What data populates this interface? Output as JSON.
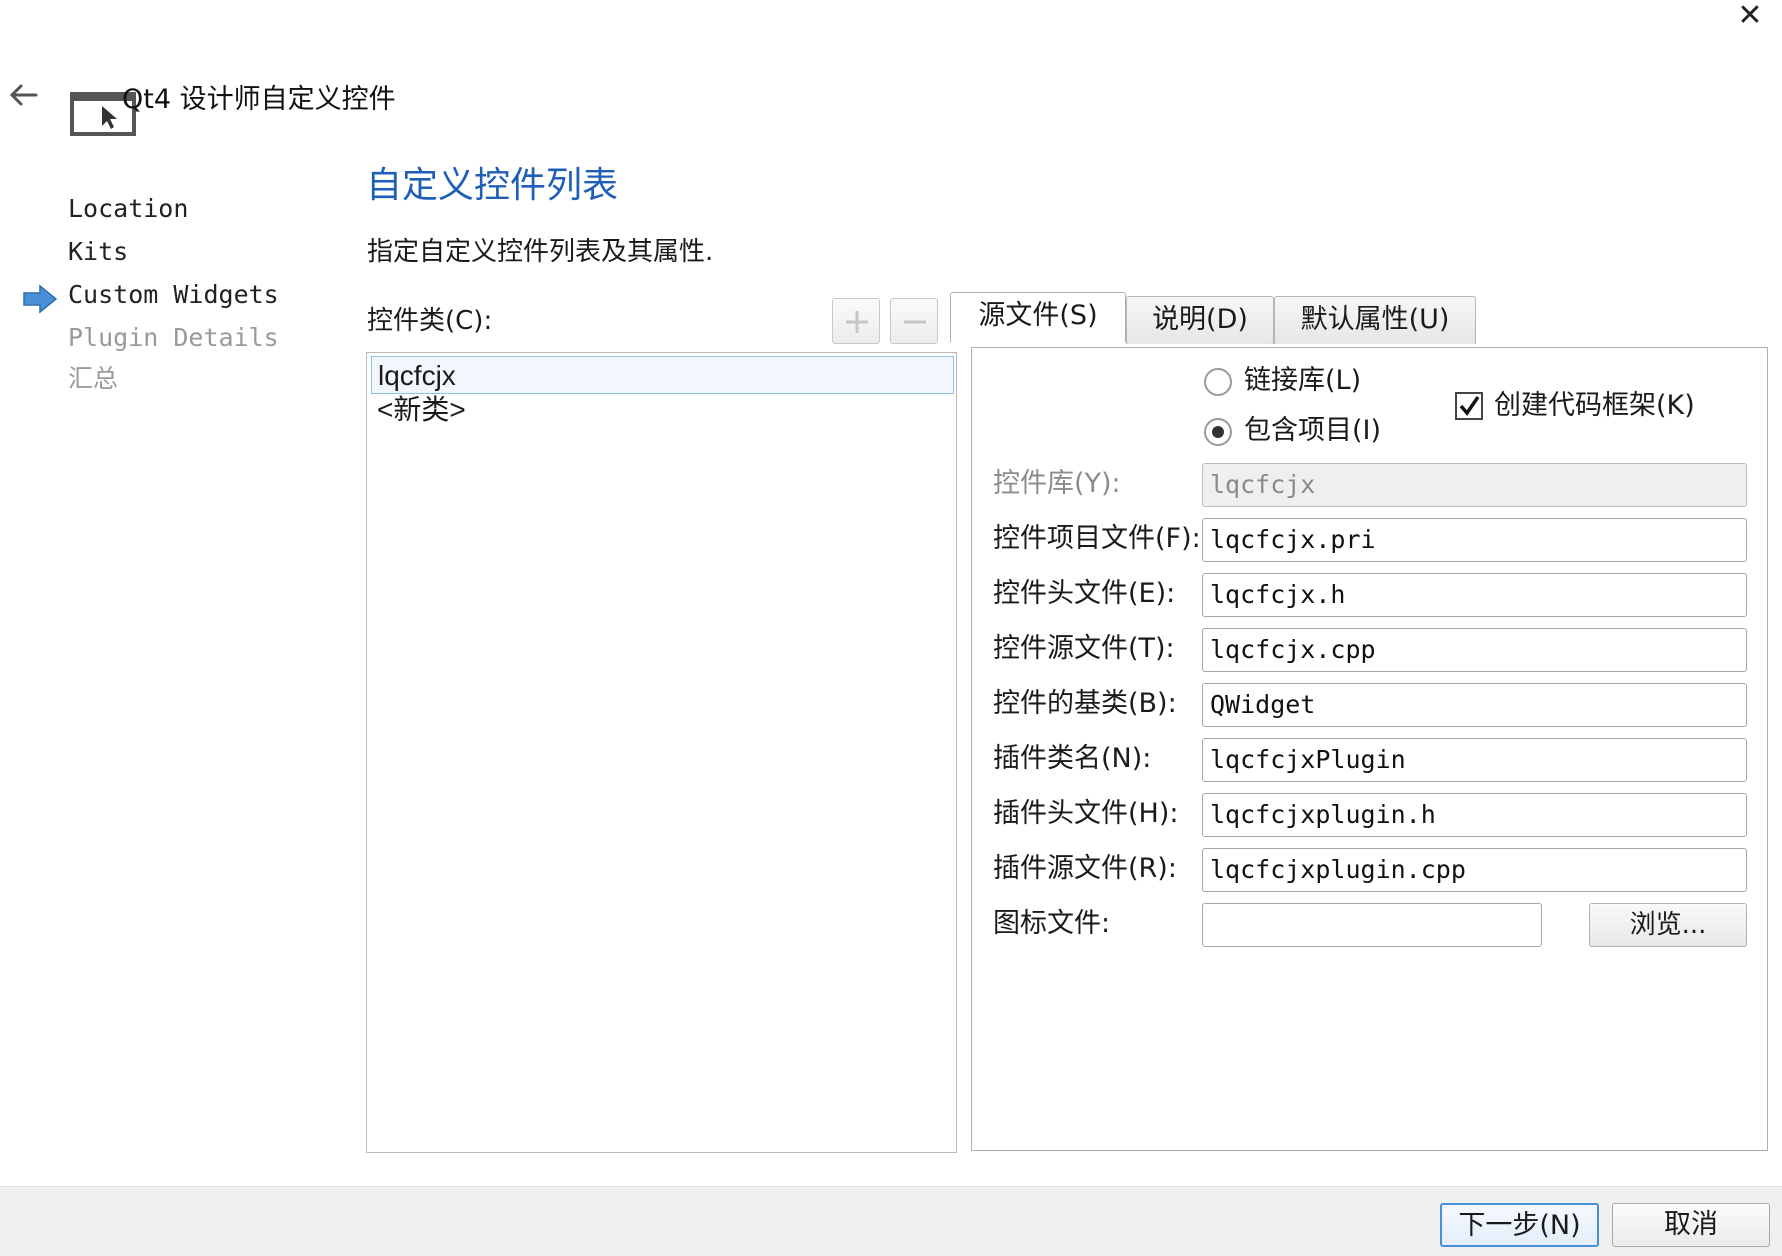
{
  "window": {
    "title": "Qt4 设计师自定义控件",
    "close_glyph": "✕",
    "back_glyph": "🡐"
  },
  "steps": [
    {
      "label": "Location",
      "state": "done"
    },
    {
      "label": "Kits",
      "state": "done"
    },
    {
      "label": "Custom Widgets",
      "state": "current"
    },
    {
      "label": "Plugin Details",
      "state": "pending"
    },
    {
      "label": "汇总",
      "state": "pending"
    }
  ],
  "page": {
    "heading": "自定义控件列表",
    "description": "指定自定义控件列表及其属性."
  },
  "class_list": {
    "label": "控件类(C):",
    "items": [
      {
        "label": "lqcfcjx",
        "selected": true
      },
      {
        "label": "<新类>",
        "selected": false
      }
    ]
  },
  "tabs": [
    {
      "label": "源文件(S)",
      "active": true
    },
    {
      "label": "说明(D)",
      "active": false
    },
    {
      "label": "默认属性(U)",
      "active": false
    }
  ],
  "options": {
    "link_library": {
      "label": "链接库(L)",
      "checked": false
    },
    "include_project": {
      "label": "包含项目(I)",
      "checked": true
    },
    "create_skeleton": {
      "label": "创建代码框架(K)",
      "checked": true
    }
  },
  "form": {
    "widget_library": {
      "label": "控件库(Y):",
      "value": "lqcfcjx"
    },
    "widget_project_file": {
      "label": "控件项目文件(F):",
      "value": "lqcfcjx.pri"
    },
    "widget_header": {
      "label": "控件头文件(E):",
      "value": "lqcfcjx.h"
    },
    "widget_source": {
      "label": "控件源文件(T):",
      "value": "lqcfcjx.cpp"
    },
    "widget_base_class": {
      "label": "控件的基类(B):",
      "value": "QWidget"
    },
    "plugin_class_name": {
      "label": "插件类名(N):",
      "value": "lqcfcjxPlugin"
    },
    "plugin_header": {
      "label": "插件头文件(H):",
      "value": "lqcfcjxplugin.h"
    },
    "plugin_source": {
      "label": "插件源文件(R):",
      "value": "lqcfcjxplugin.cpp"
    },
    "icon_file": {
      "label": "图标文件:",
      "value": ""
    },
    "browse_label": "浏览..."
  },
  "footer": {
    "next_label": "下一步(N)",
    "cancel_label": "取消"
  },
  "colors": {
    "heading": "#1f5fb8",
    "step_arrow": "#4a90d9",
    "default_button_border": "#4a8fd9",
    "selected_item_border": "#8ec1ee"
  }
}
